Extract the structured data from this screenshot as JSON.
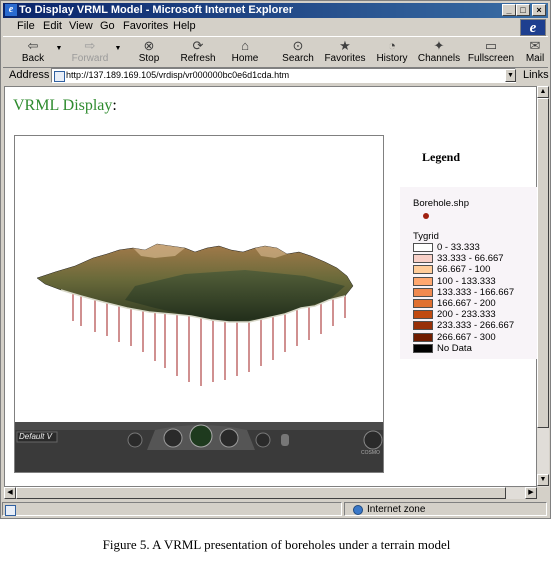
{
  "window": {
    "title": "To Display VRML Model - Microsoft Internet Explorer",
    "controls": {
      "minimize": "_",
      "maximize": "□",
      "close": "×"
    }
  },
  "menu": [
    "File",
    "Edit",
    "View",
    "Go",
    "Favorites",
    "Help"
  ],
  "toolbar": [
    {
      "label": "Back",
      "icon": "back-arrow-icon",
      "glyph": "⇦",
      "enabled": true
    },
    {
      "label": "Forward",
      "icon": "forward-arrow-icon",
      "glyph": "⇨",
      "enabled": false
    },
    {
      "label": "Stop",
      "icon": "stop-icon",
      "glyph": "⊗",
      "enabled": true
    },
    {
      "label": "Refresh",
      "icon": "refresh-icon",
      "glyph": "⟳",
      "enabled": true
    },
    {
      "label": "Home",
      "icon": "home-icon",
      "glyph": "⌂",
      "enabled": true
    },
    {
      "label": "Search",
      "icon": "search-icon",
      "glyph": "⊙",
      "enabled": true
    },
    {
      "label": "Favorites",
      "icon": "favorites-icon",
      "glyph": "★",
      "enabled": true
    },
    {
      "label": "History",
      "icon": "history-icon",
      "glyph": "◔",
      "enabled": true
    },
    {
      "label": "Channels",
      "icon": "channels-icon",
      "glyph": "✦",
      "enabled": true
    },
    {
      "label": "Fullscreen",
      "icon": "fullscreen-icon",
      "glyph": "▭",
      "enabled": true
    },
    {
      "label": "Mail",
      "icon": "mail-icon",
      "glyph": "✉",
      "enabled": true
    }
  ],
  "address": {
    "label": "Address",
    "url": "http://137.189.169.105/vrdisp/vr000000bc0e6d1cda.htm",
    "links": "Links"
  },
  "page": {
    "heading": "VRML Display",
    "heading_punct": ":",
    "viewer": {
      "viewpoint": "Default V",
      "brand": "COSMO"
    },
    "legend": {
      "title": "Legend",
      "layer1": "Borehole.shp",
      "layer2": "Tygrid",
      "classes": [
        {
          "label": "0 - 33.333",
          "color": "#ffffff"
        },
        {
          "label": "33.333 - 66.667",
          "color": "#f8d0c8"
        },
        {
          "label": "66.667 - 100",
          "color": "#ffcc99"
        },
        {
          "label": "100 - 133.333",
          "color": "#ffa870"
        },
        {
          "label": "133.333 - 166.667",
          "color": "#f08a50"
        },
        {
          "label": "166.667 - 200",
          "color": "#e07030"
        },
        {
          "label": "200 - 233.333",
          "color": "#c04a10"
        },
        {
          "label": "233.333 - 266.667",
          "color": "#983008"
        },
        {
          "label": "266.667 - 300",
          "color": "#701c00"
        },
        {
          "label": "No Data",
          "color": "#000000"
        }
      ]
    }
  },
  "status": {
    "zone": "Internet zone"
  },
  "caption": "Figure 5. A VRML presentation of boreholes under a terrain model"
}
